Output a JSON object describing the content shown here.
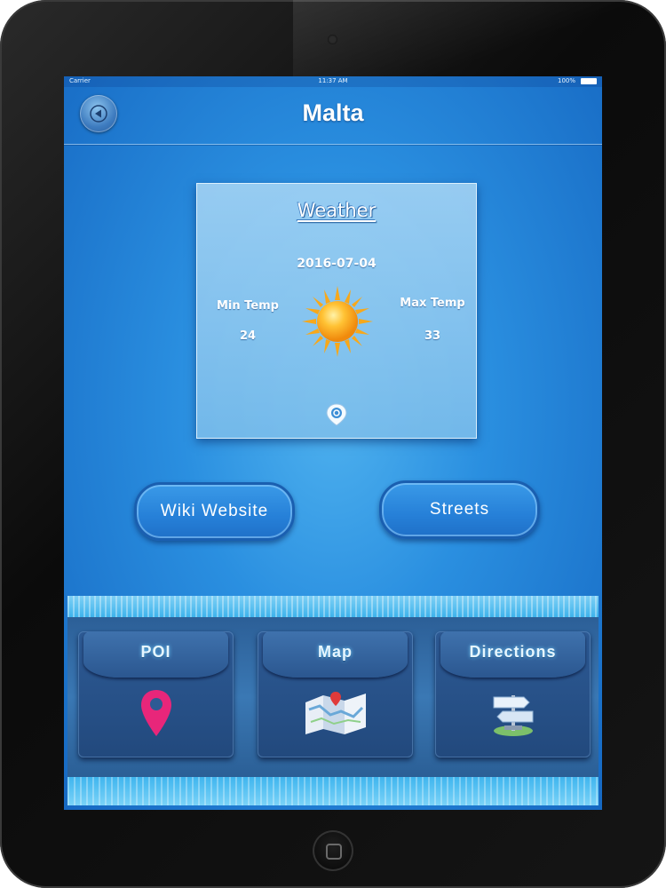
{
  "status_bar": {
    "carrier": "Carrier",
    "time": "11:37 AM",
    "battery": "100%"
  },
  "header": {
    "title": "Malta",
    "back_icon": "back-arrow-icon"
  },
  "weather": {
    "title": "Weather",
    "date": "2016-07-04",
    "min_label": "Min Temp",
    "min_value": "24",
    "max_label": "Max Temp",
    "max_value": "33",
    "condition_icon": "sun-icon",
    "locate_icon": "location-icon"
  },
  "buttons": {
    "wiki": "Wiki Website",
    "streets": "Streets"
  },
  "bottom_tiles": [
    {
      "label": "POI",
      "icon": "map-pin-icon"
    },
    {
      "label": "Map",
      "icon": "folded-map-icon"
    },
    {
      "label": "Directions",
      "icon": "signpost-icon"
    }
  ],
  "colors": {
    "screen_background": "#2a8fe0",
    "tile_background": "#2d5a94",
    "poi_pin": "#e8267a",
    "sun": "#f7a81b"
  }
}
